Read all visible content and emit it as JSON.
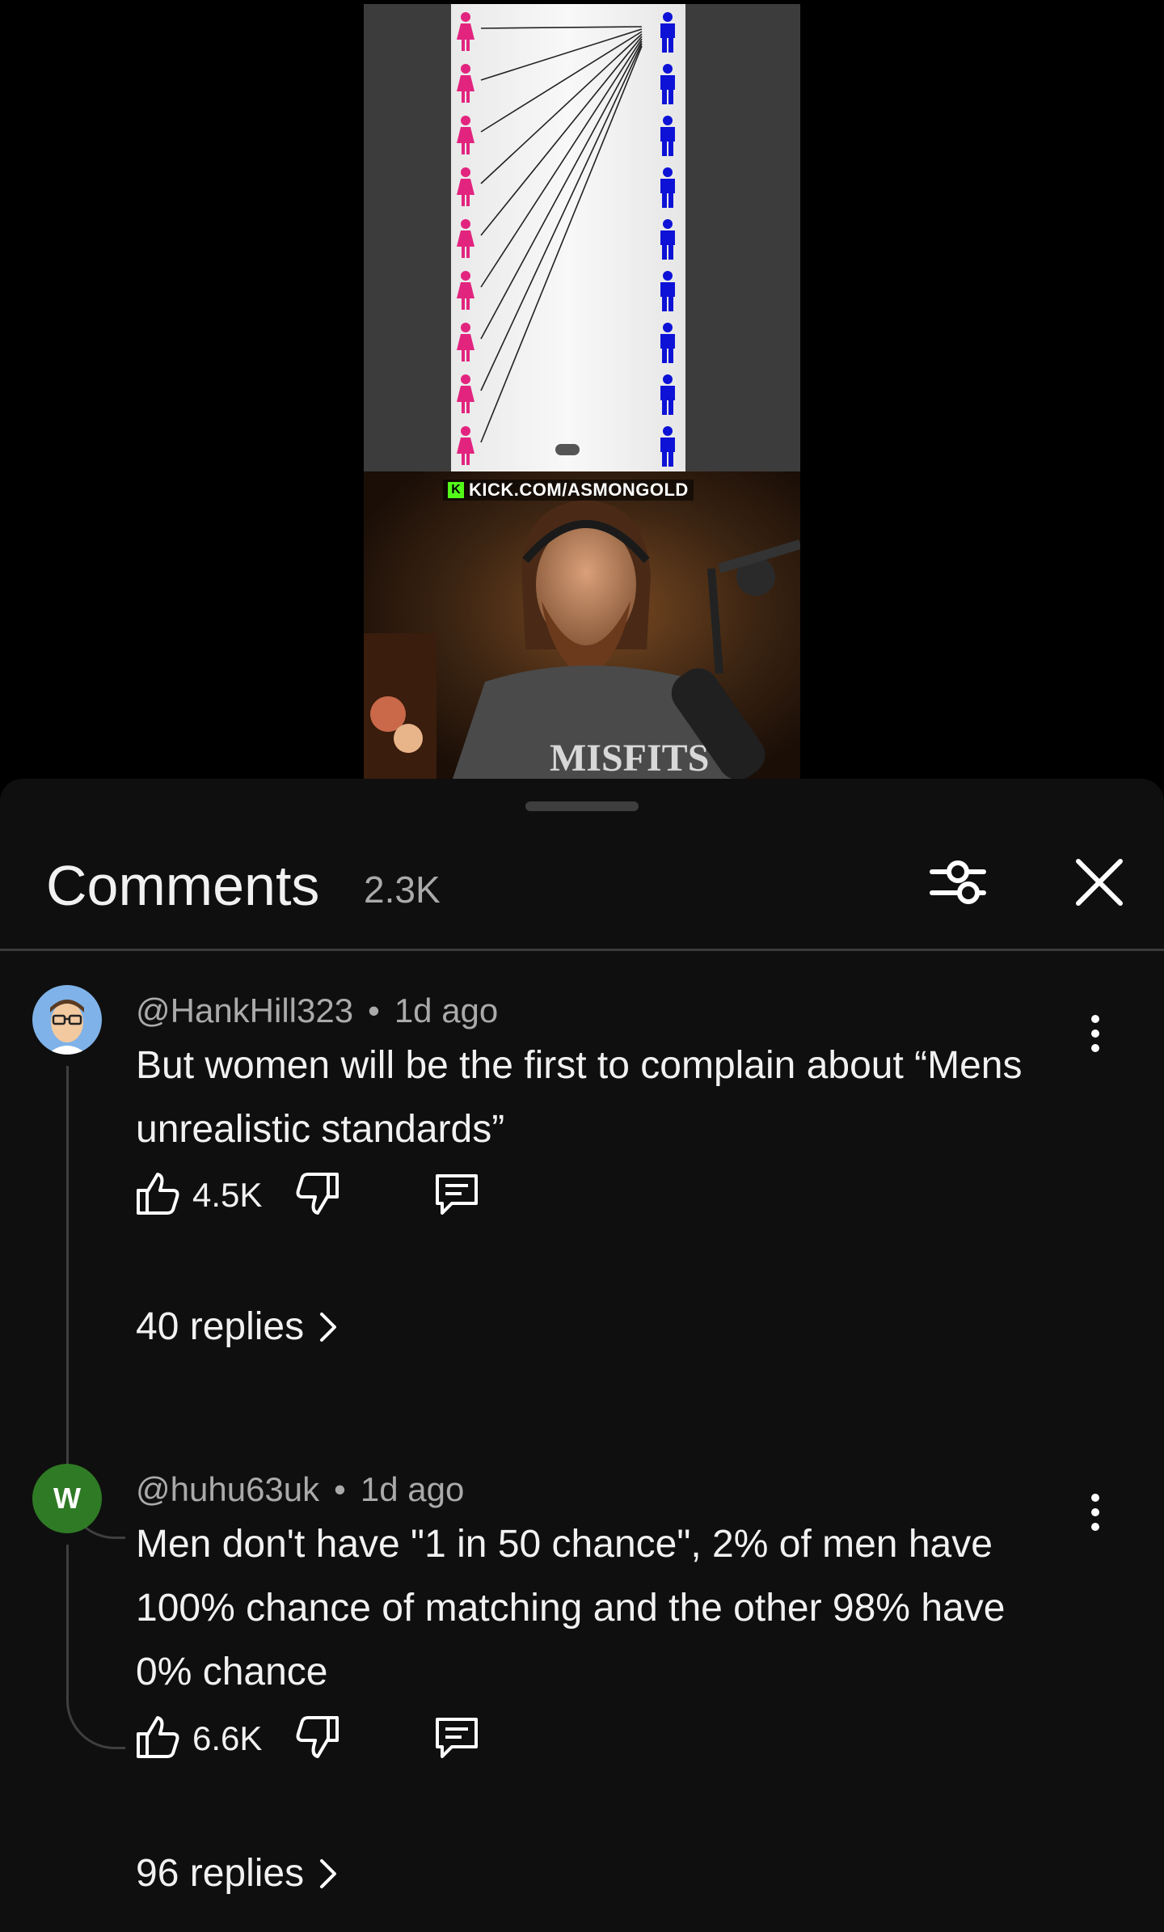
{
  "video": {
    "watermark": "KICK.COM/ASMONGOLD",
    "colors": {
      "women": "#e2247f",
      "men": "#0d12d6"
    }
  },
  "comments_panel": {
    "title": "Comments",
    "count": "2.3K"
  },
  "comments": [
    {
      "handle": "@HankHill323",
      "time": "1d ago",
      "text_lines": [
        "But women will be the first to complain about “Mens",
        "unrealistic standards”"
      ],
      "likes": "4.5K",
      "replies": "40 replies",
      "avatar": "cartoon-avatar"
    },
    {
      "handle": "@huhu63uk",
      "time": "1d ago",
      "text_lines": [
        "Men don't have \"1 in 50 chance\", 2% of men have",
        "100% chance of matching and the other 98% have",
        "0% chance"
      ],
      "likes": "6.6K",
      "replies": "96 replies",
      "avatar_letter": "W",
      "avatar_color": "#2f7a25"
    }
  ]
}
